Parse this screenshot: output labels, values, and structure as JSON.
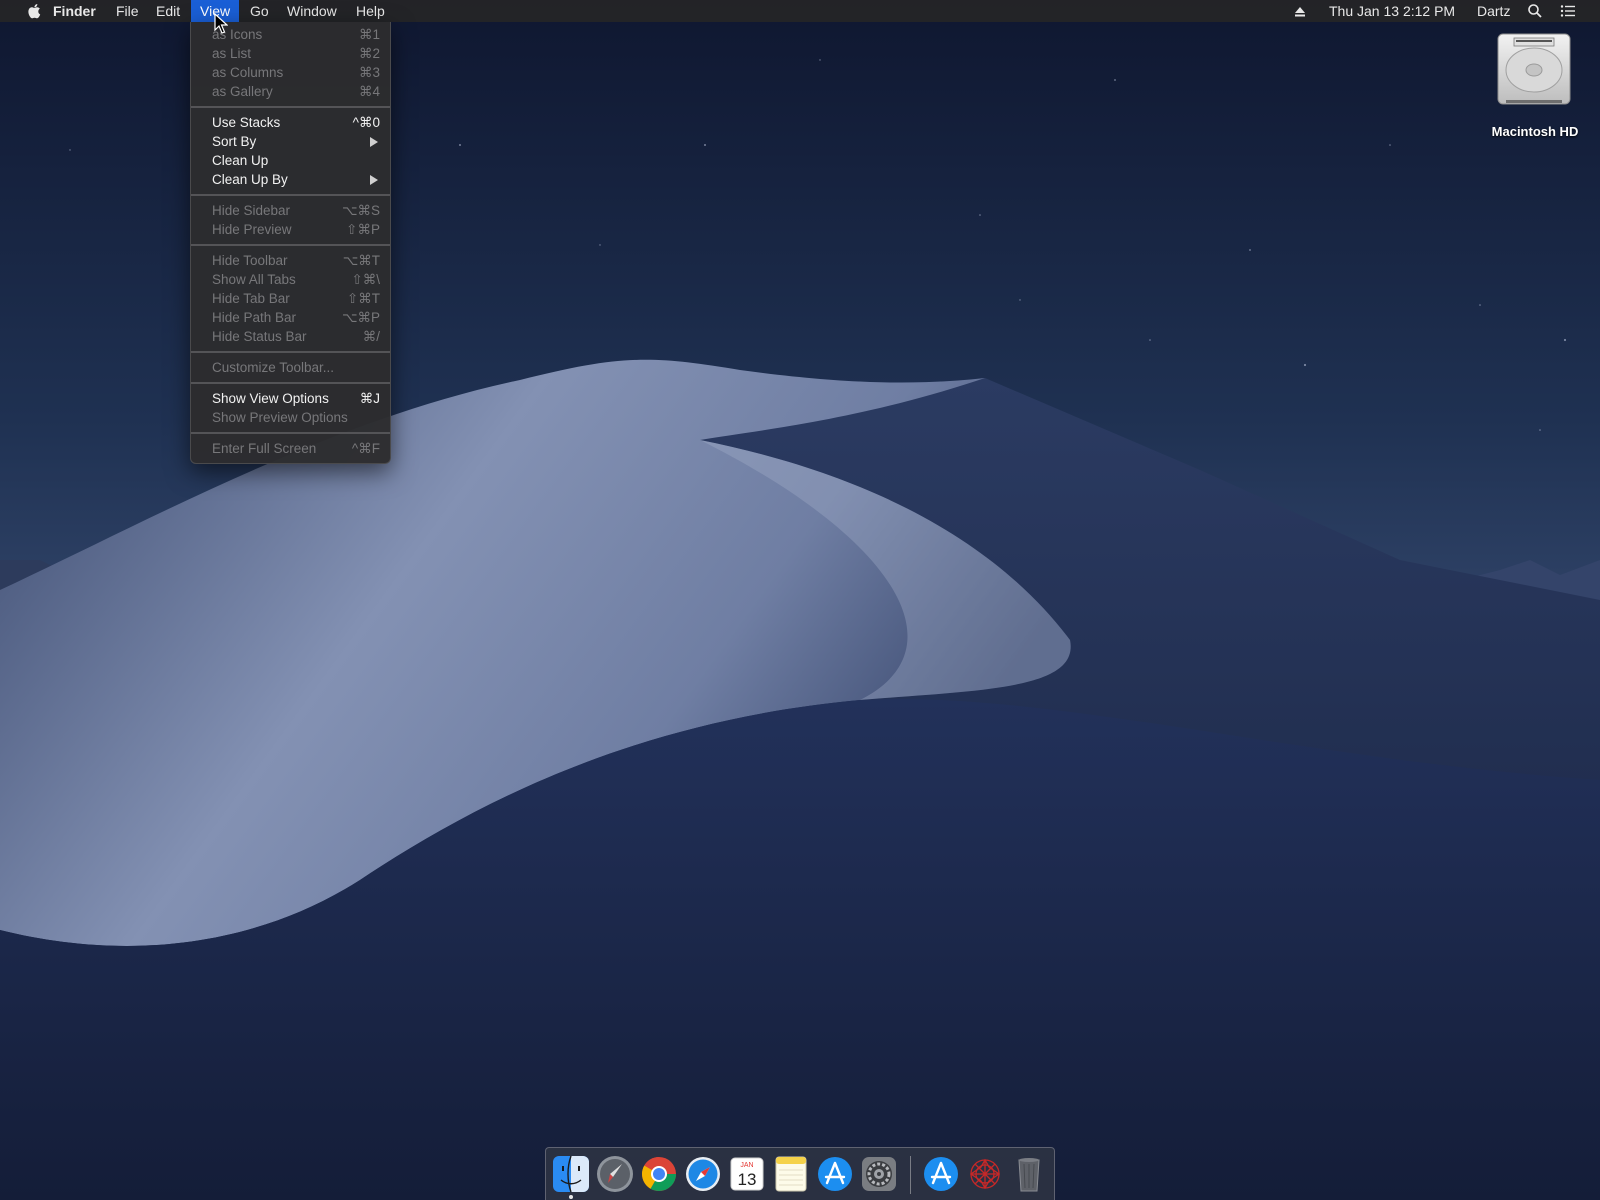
{
  "menubar": {
    "apple_icon": "apple-icon",
    "app_name": "Finder",
    "menus": [
      "File",
      "Edit",
      "View",
      "Go",
      "Window",
      "Help"
    ],
    "active_menu": "View",
    "status": {
      "eject_icon": "eject-icon",
      "datetime": "Thu Jan 13  2:12 PM",
      "user": "Dartz",
      "search_icon": "spotlight-search-icon",
      "notification_icon": "notification-center-icon"
    }
  },
  "view_menu": {
    "items": [
      {
        "label": "as Icons",
        "shortcut": "⌘1",
        "enabled": false
      },
      {
        "label": "as List",
        "shortcut": "⌘2",
        "enabled": false
      },
      {
        "label": "as Columns",
        "shortcut": "⌘3",
        "enabled": false
      },
      {
        "label": "as Gallery",
        "shortcut": "⌘4",
        "enabled": false
      },
      {
        "label": "Use Stacks",
        "shortcut": "^⌘0",
        "enabled": true
      },
      {
        "label": "Sort By",
        "shortcut": "",
        "enabled": true,
        "submenu": true
      },
      {
        "label": "Clean Up",
        "shortcut": "",
        "enabled": true
      },
      {
        "label": "Clean Up By",
        "shortcut": "",
        "enabled": true,
        "submenu": true
      },
      {
        "label": "Hide Sidebar",
        "shortcut": "⌥⌘S",
        "enabled": false
      },
      {
        "label": "Hide Preview",
        "shortcut": "⇧⌘P",
        "enabled": false
      },
      {
        "label": "Hide Toolbar",
        "shortcut": "⌥⌘T",
        "enabled": false
      },
      {
        "label": "Show All Tabs",
        "shortcut": "⇧⌘\\",
        "enabled": false
      },
      {
        "label": "Hide Tab Bar",
        "shortcut": "⇧⌘T",
        "enabled": false
      },
      {
        "label": "Hide Path Bar",
        "shortcut": "⌥⌘P",
        "enabled": false
      },
      {
        "label": "Hide Status Bar",
        "shortcut": "⌘/",
        "enabled": false
      },
      {
        "label": "Customize Toolbar...",
        "shortcut": "",
        "enabled": false
      },
      {
        "label": "Show View Options",
        "shortcut": "⌘J",
        "enabled": true
      },
      {
        "label": "Show Preview Options",
        "shortcut": "",
        "enabled": false
      },
      {
        "label": "Enter Full Screen",
        "shortcut": "^⌘F",
        "enabled": false
      }
    ]
  },
  "desktop": {
    "icons": [
      {
        "label": "Macintosh HD",
        "icon": "hard-drive-icon"
      }
    ]
  },
  "dock": {
    "apps": [
      {
        "name": "finder-icon",
        "running": true
      },
      {
        "name": "launchpad-icon",
        "running": false
      },
      {
        "name": "chrome-icon",
        "running": false
      },
      {
        "name": "safari-icon",
        "running": false
      },
      {
        "name": "calendar-icon",
        "running": false,
        "month": "JAN",
        "day": "13"
      },
      {
        "name": "notes-icon",
        "running": false
      },
      {
        "name": "app-store-icon",
        "running": false
      },
      {
        "name": "system-preferences-icon",
        "running": false
      },
      {
        "name": "app-store-folder-icon",
        "running": false
      },
      {
        "name": "red-spiral-app-icon",
        "running": false
      },
      {
        "name": "trash-icon",
        "running": false
      }
    ]
  },
  "colors": {
    "menu_highlight": "#1a5fd6",
    "menubar_bg": "#242426",
    "menu_bg": "#2c2c2e",
    "sky_top": "#111a33",
    "dune_light": "#7b89ad"
  }
}
